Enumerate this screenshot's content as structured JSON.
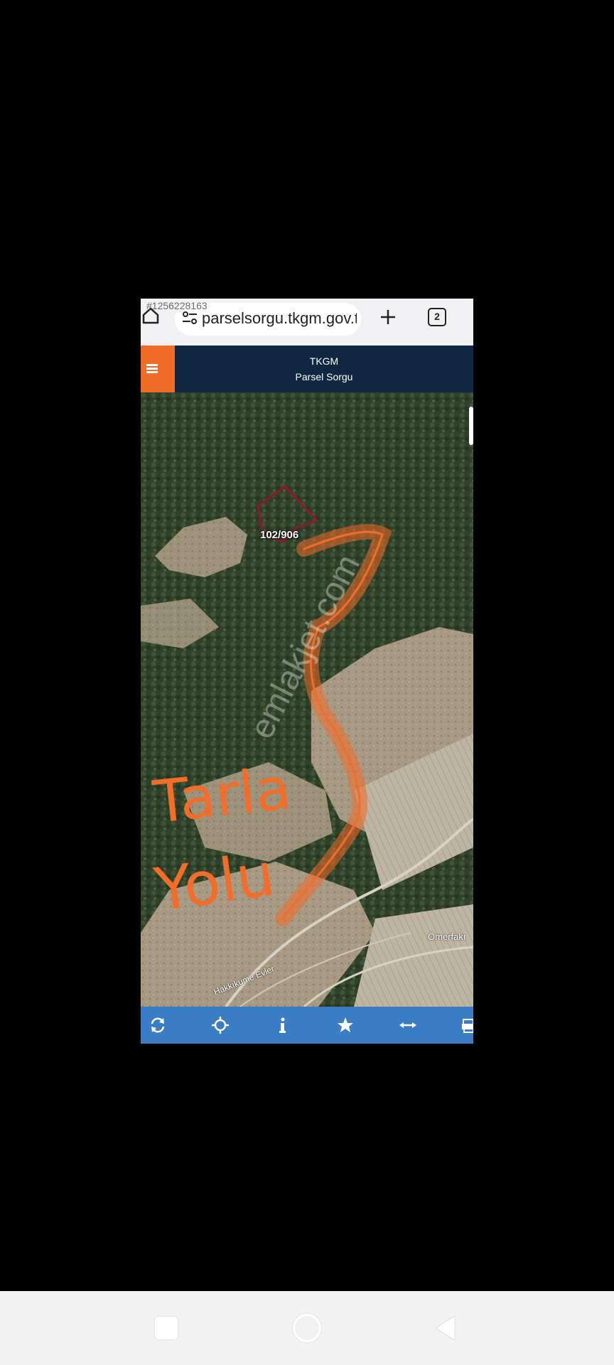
{
  "browser": {
    "ad_id": "#1256228163",
    "url": "parselsorgu.tkgm.gov.tr",
    "tab_count": "2"
  },
  "app": {
    "title": "TKGM",
    "subtitle": "Parsel Sorgu"
  },
  "map": {
    "parcel_label": "102/906",
    "road_label_1": "Ömerfakı",
    "road_label_2": "Hakkıkume Evler",
    "annotation_line1": "Tarla",
    "annotation_line2": "Yolu",
    "watermark": "emlakjet.com",
    "colors": {
      "parcel": "#8b1a2a",
      "annotation": "#f26c2a"
    }
  },
  "toolbar": {
    "tools": [
      "refresh-icon",
      "locate-icon",
      "info-icon",
      "star-icon",
      "measure-icon",
      "print-icon"
    ]
  },
  "colors": {
    "header_bg": "#0f2740",
    "menu_bg": "#f26c2a",
    "toolbar_bg": "#3b7dc4"
  }
}
